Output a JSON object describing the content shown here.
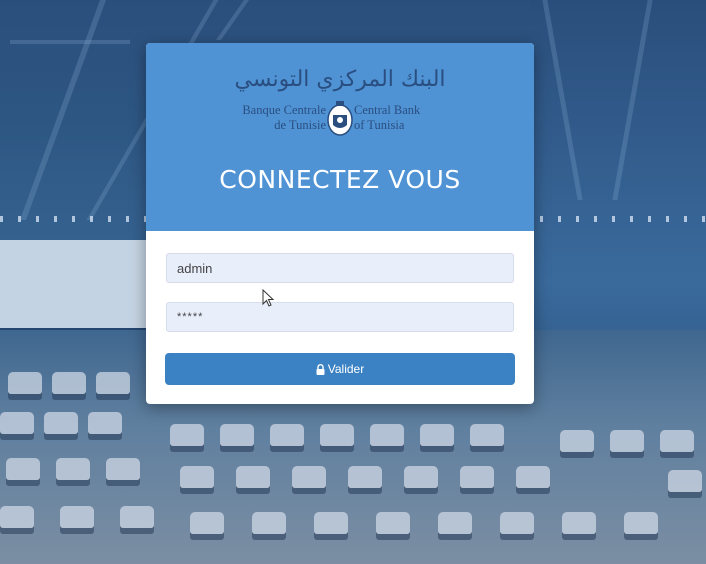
{
  "bank": {
    "name_ar": "البنك المركزي التونسي",
    "name_fr_line1": "Banque Centrale",
    "name_fr_line2": "de Tunisie",
    "name_en_line1": "Central Bank",
    "name_en_line2": "of Tunisia",
    "emblem_icon": "bank-emblem-icon"
  },
  "login": {
    "title": "CONNECTEZ VOUS",
    "username_value": "admin",
    "password_value": "*****",
    "submit_label": "Valider",
    "submit_icon": "lock-icon"
  },
  "colors": {
    "header": "#4f93d5",
    "button": "#3b82c4",
    "field_bg": "#e9eefb",
    "logo_text": "#2a4e80"
  }
}
